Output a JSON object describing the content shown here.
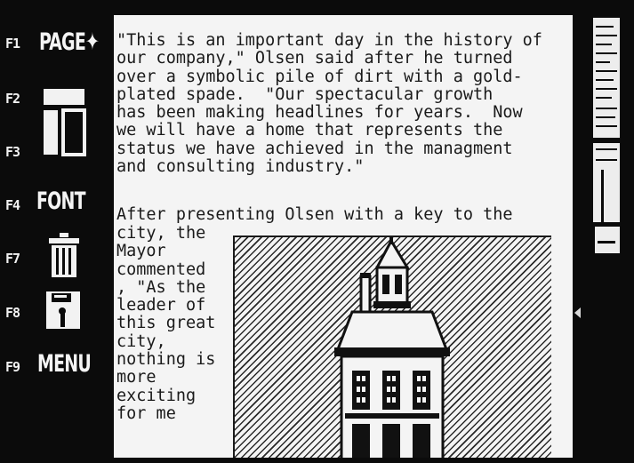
{
  "function_keys": {
    "f1": {
      "key": "F1",
      "label": "PAGE✦"
    },
    "f2": {
      "key": "F2"
    },
    "f3": {
      "key": "F3"
    },
    "f4": {
      "key": "F4",
      "label": "FONT"
    },
    "f7": {
      "key": "F7"
    },
    "f8": {
      "key": "F8"
    },
    "f9": {
      "key": "F9",
      "label": "MENU"
    }
  },
  "icons": {
    "f2_f3": "page-layout-icon",
    "f7": "trash-can-icon",
    "f8": "floppy-disk-icon",
    "gauge": "scroll-position-gauge-icon"
  },
  "document": {
    "paragraph1": "\"This is an important day in the history of\nour company,\" Olsen said after he turned\nover a symbolic pile of dirt with a gold-\nplated spade.  \"Our spectacular growth\nhas been making headlines for years.  Now\nwe will have a home that represents the\nstatus we have achieved in the managment\nand consulting industry.\"",
    "paragraph2": "After presenting Olsen with a key to the",
    "wrapped": "city, the\nMayor\ncommented\n, \"As the\nleader of\nthis great\ncity,\nnothing is\nmore\nexciting\nfor me"
  },
  "colors": {
    "screen": "#f4f4f4",
    "ink": "#1a1a1a",
    "bezel": "#0b0b0b"
  }
}
